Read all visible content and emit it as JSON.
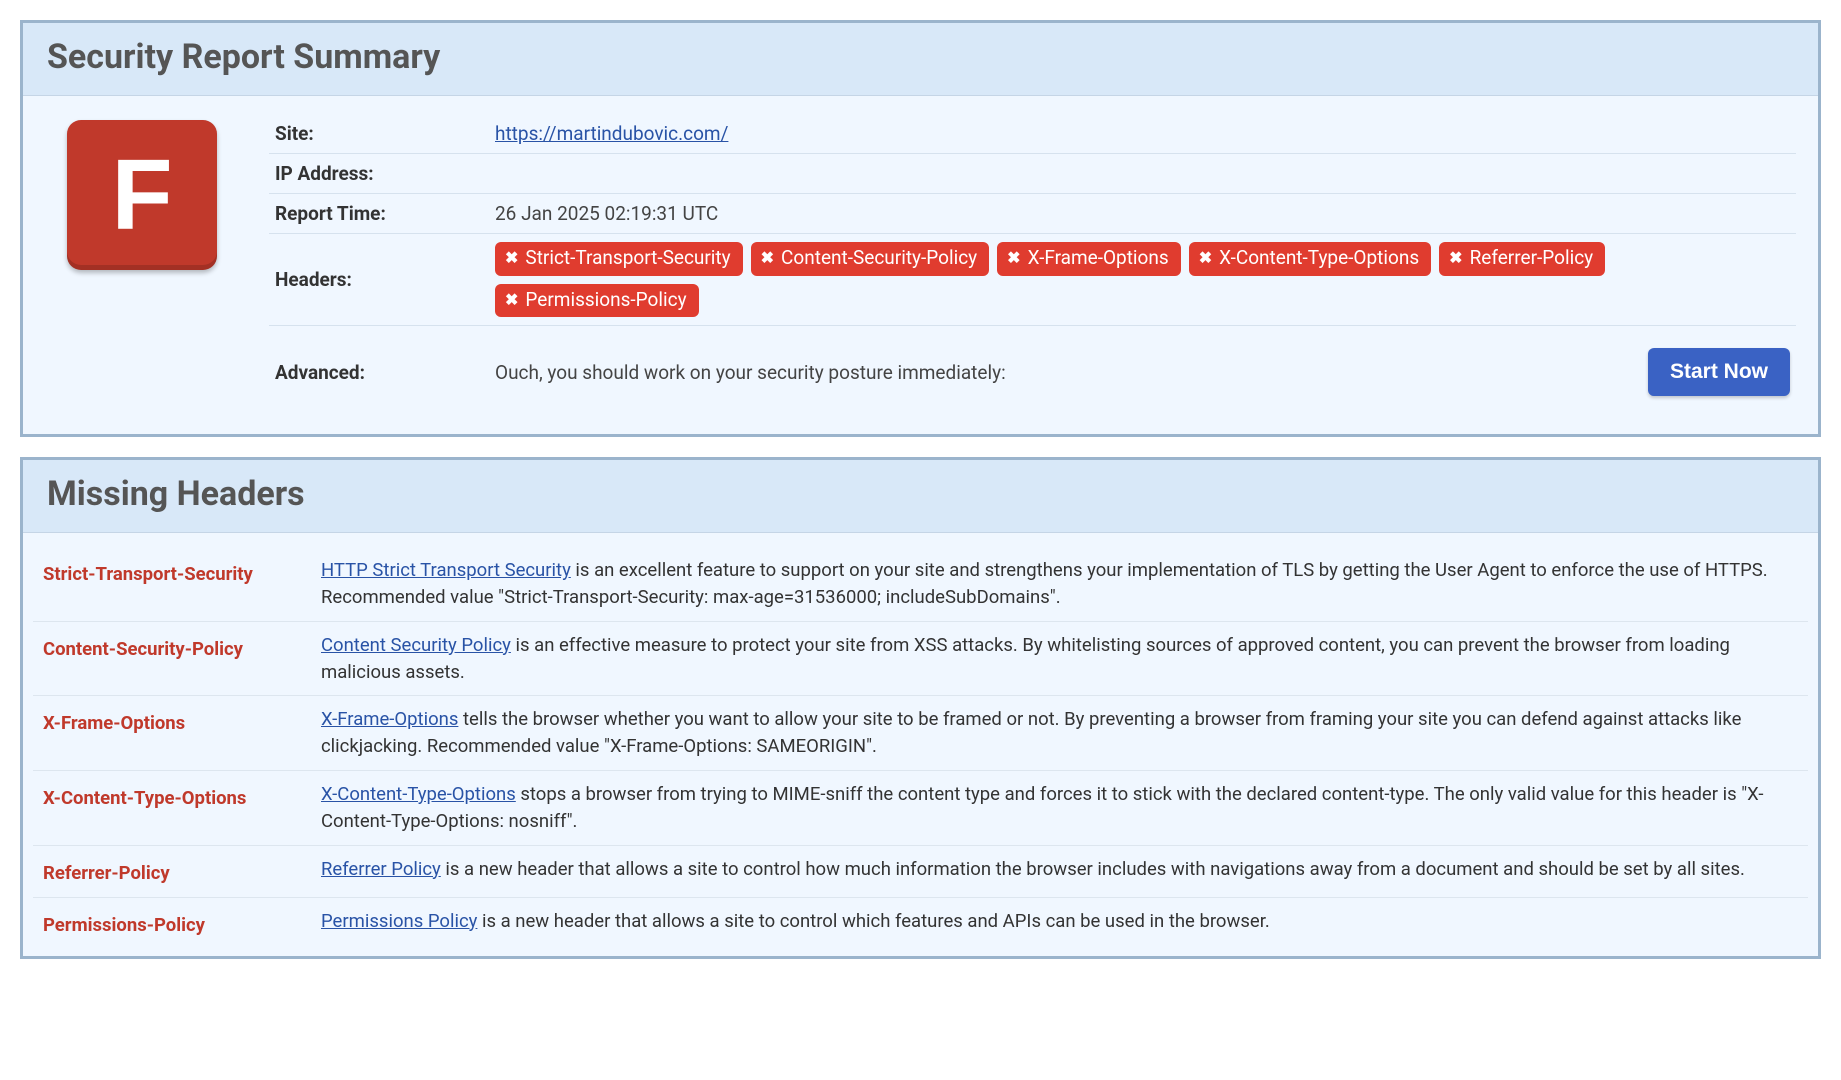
{
  "summary": {
    "title": "Security Report Summary",
    "grade": "F",
    "labels": {
      "site": "Site:",
      "ip": "IP Address:",
      "report_time": "Report Time:",
      "headers": "Headers:",
      "advanced": "Advanced:"
    },
    "site_url": "https://martindubovic.com/",
    "ip_address": "",
    "report_time": "26 Jan 2025 02:19:31 UTC",
    "header_pills": [
      "Strict-Transport-Security",
      "Content-Security-Policy",
      "X-Frame-Options",
      "X-Content-Type-Options",
      "Referrer-Policy",
      "Permissions-Policy"
    ],
    "advanced_msg": "Ouch, you should work on your security posture immediately:",
    "start_btn": "Start Now"
  },
  "missing": {
    "title": "Missing Headers",
    "rows": [
      {
        "name": "Strict-Transport-Security",
        "link_text": "HTTP Strict Transport Security",
        "rest": " is an excellent feature to support on your site and strengthens your implementation of TLS by getting the User Agent to enforce the use of HTTPS. Recommended value \"Strict-Transport-Security: max-age=31536000; includeSubDomains\"."
      },
      {
        "name": "Content-Security-Policy",
        "link_text": "Content Security Policy",
        "rest": " is an effective measure to protect your site from XSS attacks. By whitelisting sources of approved content, you can prevent the browser from loading malicious assets."
      },
      {
        "name": "X-Frame-Options",
        "link_text": "X-Frame-Options",
        "rest": " tells the browser whether you want to allow your site to be framed or not. By preventing a browser from framing your site you can defend against attacks like clickjacking. Recommended value \"X-Frame-Options: SAMEORIGIN\"."
      },
      {
        "name": "X-Content-Type-Options",
        "link_text": "X-Content-Type-Options",
        "rest": " stops a browser from trying to MIME-sniff the content type and forces it to stick with the declared content-type. The only valid value for this header is \"X-Content-Type-Options: nosniff\"."
      },
      {
        "name": "Referrer-Policy",
        "link_text": "Referrer Policy",
        "rest": " is a new header that allows a site to control how much information the browser includes with navigations away from a document and should be set by all sites."
      },
      {
        "name": "Permissions-Policy",
        "link_text": "Permissions Policy",
        "rest": " is a new header that allows a site to control which features and APIs can be used in the browser."
      }
    ]
  }
}
